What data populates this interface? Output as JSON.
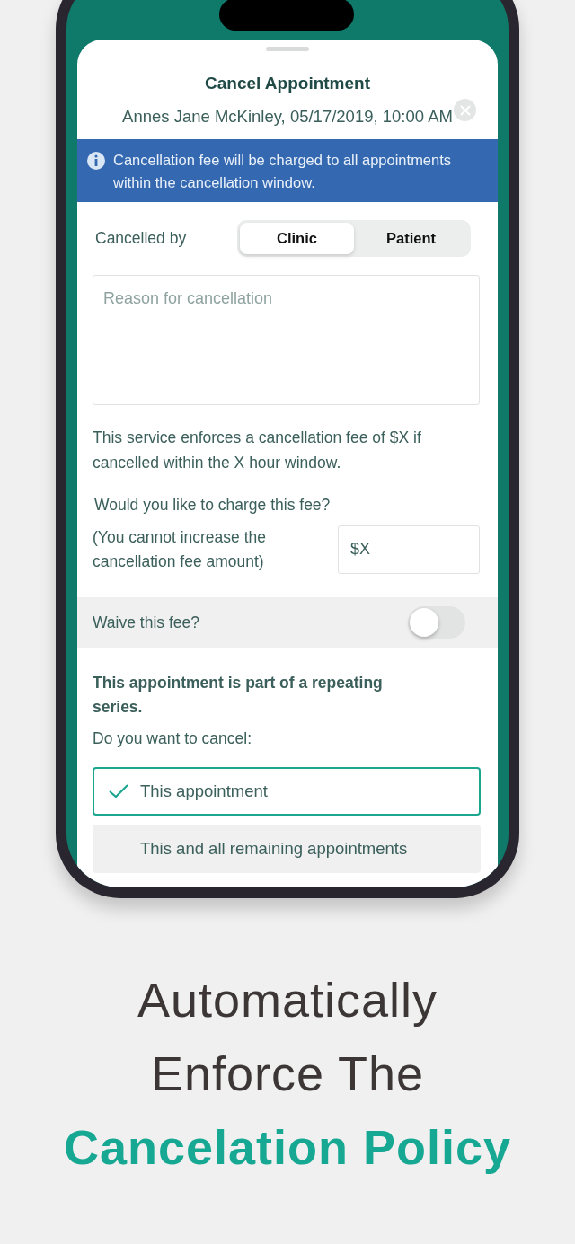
{
  "modal": {
    "title": "Cancel Appointment",
    "subtitle": "Annes Jane McKinley, 05/17/2019, 10:00 AM",
    "notice": "Cancellation fee will be charged to all appointments within the cancellation window.",
    "cancelled_by": {
      "label": "Cancelled by",
      "options": [
        {
          "label": "Clinic",
          "selected": true
        },
        {
          "label": "Patient",
          "selected": false
        }
      ]
    },
    "reason": {
      "placeholder": "Reason for cancellation"
    },
    "fee_policy": "This service enforces a cancellation fee of $X if cancelled within the X hour window.",
    "charge_question": "Would you like to charge this fee?",
    "charge_note": "(You cannot increase the cancellation fee amount)",
    "fee_amount": {
      "value": "$X"
    },
    "waive": {
      "label": "Waive this fee?",
      "on": false
    },
    "series_heading": "This appointment is part of a repeating series.",
    "cancel_question": "Do you want to cancel:",
    "cancel_options": [
      {
        "label": "This appointment",
        "selected": true
      },
      {
        "label": "This and all remaining appointments",
        "selected": false
      }
    ]
  },
  "headline": {
    "lines": [
      {
        "text": "Automatically",
        "accent": false
      },
      {
        "text": "Enforce The",
        "accent": false
      },
      {
        "text": "Cancelation Policy",
        "accent": true
      }
    ]
  }
}
